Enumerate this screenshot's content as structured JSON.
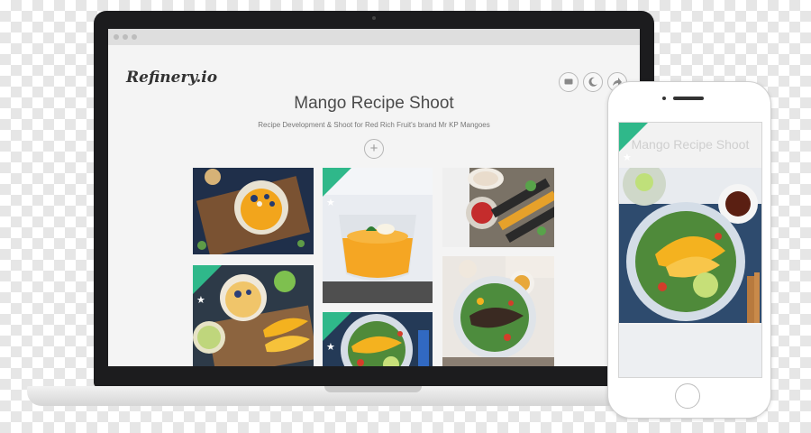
{
  "app": {
    "logo": "Refinery.io",
    "title": "Mango Recipe Shoot",
    "subtitle": "Recipe Development & Shoot for Red Rich Fruit's brand Mr KP Mangoes"
  },
  "toolbar": {
    "icons": [
      "comment-icon",
      "night-mode-icon",
      "share-icon"
    ],
    "add_label": "+"
  },
  "gallery": {
    "badge_color": "#2fb88a",
    "star_glyph": "★",
    "tiles": [
      {
        "subject": "smoothie bowl with blueberries",
        "starred": false
      },
      {
        "subject": "mango dessert in glass",
        "starred": true
      },
      {
        "subject": "grilled skewers with dipping sauces",
        "starred": false
      },
      {
        "subject": "mango smoothie glasses with sliced mango",
        "starred": true
      },
      {
        "subject": "mango salad bowl",
        "starred": true
      },
      {
        "subject": "grilled meat salad",
        "starred": false
      }
    ]
  },
  "phone": {
    "title": "Mango Recipe Shoot",
    "star_glyph": "★"
  },
  "colors": {
    "accent": "#2fb88a",
    "laptop_frame": "#1c1c1e",
    "page_bg": "#f4f4f4"
  }
}
